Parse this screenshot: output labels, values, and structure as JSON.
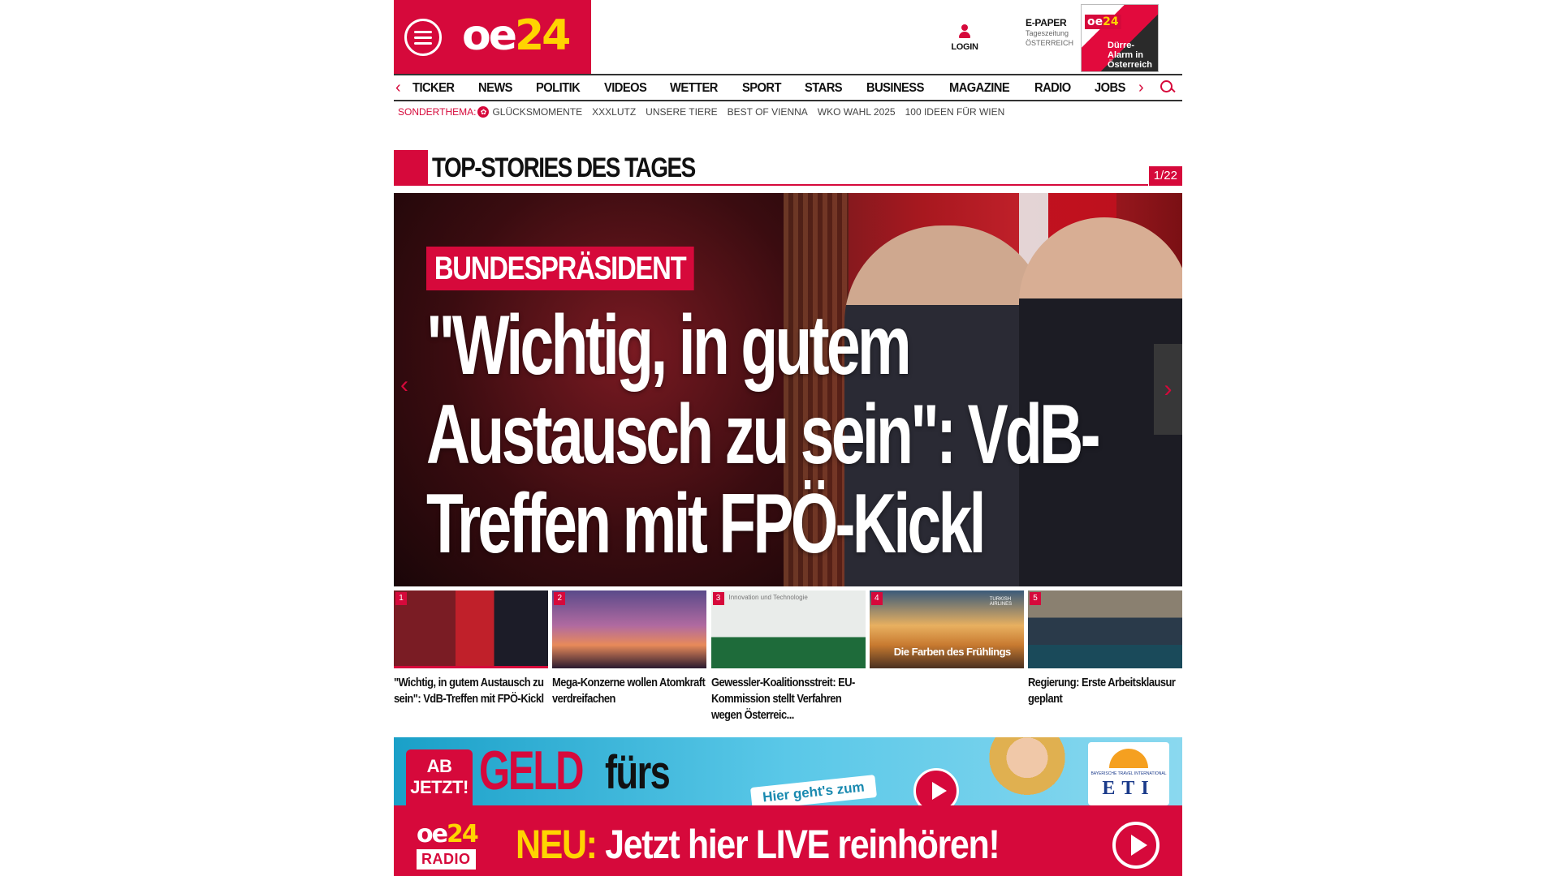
{
  "header": {
    "logo_oe": "oe",
    "logo_24": "24",
    "login_label": "LOGIN",
    "epaper_title": "E-PAPER",
    "epaper_sub1": "Tageszeitung",
    "epaper_sub2": "ÖSTERREICH",
    "epaper_headline": "Dürre-Alarm in Österreich"
  },
  "nav": {
    "items": [
      "TICKER",
      "NEWS",
      "POLITIK",
      "VIDEOS",
      "WETTER",
      "SPORT",
      "STARS",
      "BUSINESS",
      "MAGAZINE",
      "RADIO",
      "JOBS"
    ],
    "prev_arrow": "‹",
    "next_arrow": "›"
  },
  "sub_nav": {
    "label": "SONDERTHEMA:",
    "items": [
      "GLÜCKSMOMENTE",
      "XXXLUTZ",
      "UNSERE TIERE",
      "BEST OF VIENNA",
      "WKO WAHL 2025",
      "100 IDEEN FÜR WIEN"
    ]
  },
  "section": {
    "title": "TOP-STORIES DES TAGES",
    "counter": "1/22"
  },
  "hero": {
    "badge": "BUNDESPRÄSIDENT",
    "headline": "\"Wichtig, in gutem Austausch zu sein\": VdB-Treffen mit FPÖ-Kickl",
    "prev": "‹",
    "next": "›"
  },
  "thumbs": [
    {
      "num": "1",
      "title": "\"Wichtig, in gutem Austausch zu sein\": VdB-Treffen mit FPÖ-Kickl"
    },
    {
      "num": "2",
      "title": "Mega-Konzerne wollen Atomkraft verdreifachen"
    },
    {
      "num": "3",
      "title": "Gewessler-Koalitionsstreit: EU-Kommission stellt Verfahren wegen Österreic...",
      "caption": "Innovation und Technologie"
    },
    {
      "num": "4",
      "title": "",
      "caption": "Die Farben des Frühlings",
      "airline": "TURKISH AIRLINES"
    },
    {
      "num": "5",
      "title": "Regierung: Erste Arbeitsklausur geplant"
    }
  ],
  "ad": {
    "badge_line1": "AB",
    "badge_line2": "JETZT!",
    "geld": "GELD",
    "furs": "fürs",
    "cta": "Hier geht's zum",
    "eti": "ETI",
    "eti_sub": "BAYERISCHE TRAVEL INTERNATIONAL"
  },
  "radio": {
    "logo_oe": "oe",
    "logo_24": "24",
    "label": "RADIO",
    "neu": "NEU:",
    "text": " Jetzt hier LIVE reinhören!"
  },
  "colors": {
    "brand_red": "#d6093b",
    "brand_yellow": "#ffd400"
  }
}
